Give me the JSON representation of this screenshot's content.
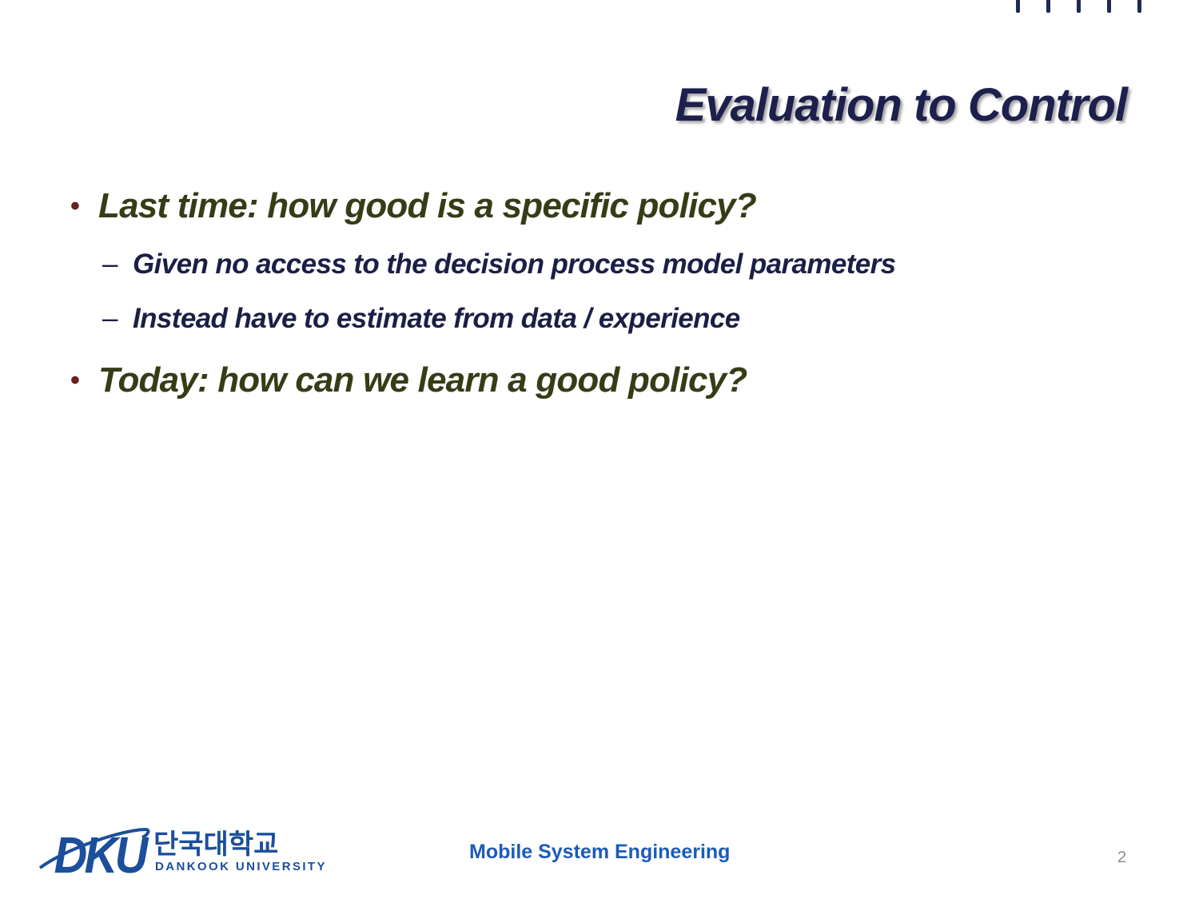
{
  "slide": {
    "title": "Evaluation to Control",
    "bullets": [
      {
        "marker": "•",
        "text": "Last time: how good is a specific policy?",
        "sub": [
          {
            "marker": "–",
            "text": "Given no access to the decision process model parameters"
          },
          {
            "marker": "–",
            "text": "Instead have to estimate from data / experience"
          }
        ]
      },
      {
        "marker": "•",
        "text": "Today: how can we learn a good policy?",
        "sub": []
      }
    ],
    "footer": {
      "logo_letters": "DKU",
      "logo_korean": "단국대학교",
      "logo_english": "DANKOOK UNIVERSITY",
      "center_text": "Mobile System Engineering",
      "page_number": "2"
    }
  },
  "colors": {
    "title": "#1d1f4d",
    "bullet_text": "#343d16",
    "bullet_marker": "#6b1f1f",
    "sub_text": "#1b1f45",
    "footer_text": "#1d5bb8",
    "logo_blue": "#1b4f9c",
    "page_number": "#8a8a8a",
    "top_ticks": "#1c2a55"
  }
}
